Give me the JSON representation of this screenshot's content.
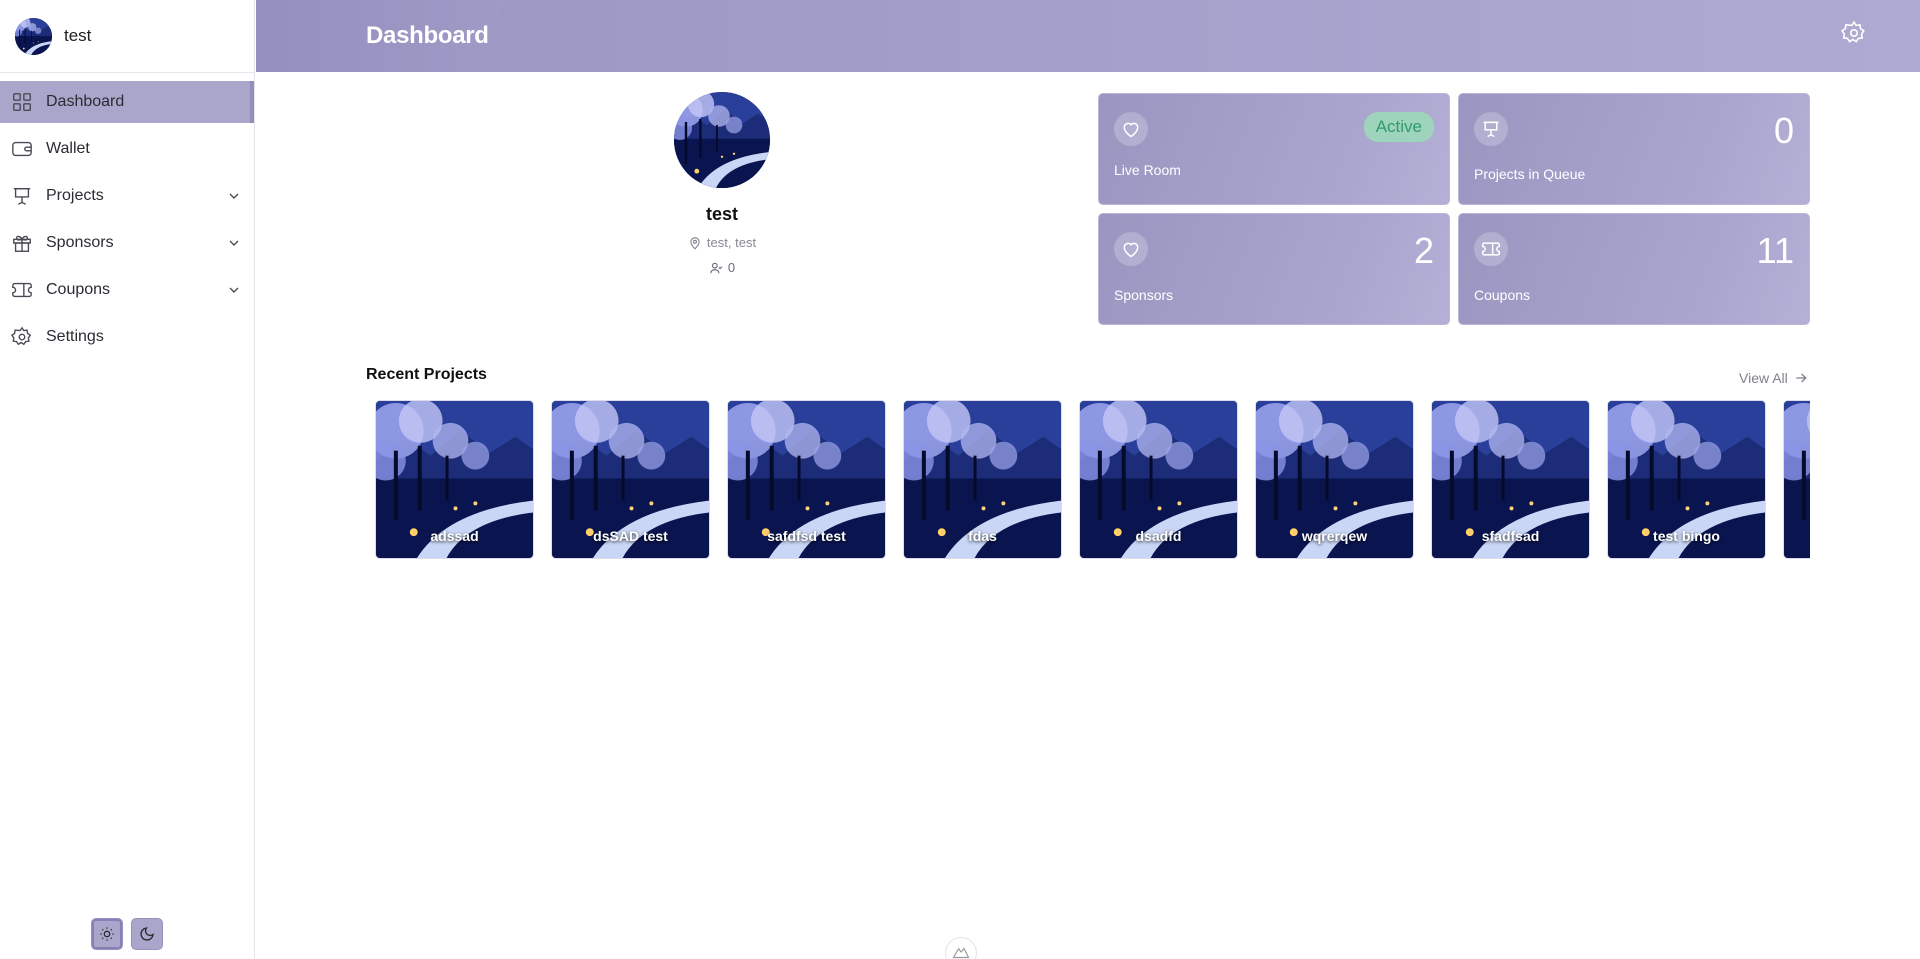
{
  "user": {
    "name": "test"
  },
  "sidebar": {
    "items": [
      {
        "label": "Dashboard",
        "icon": "dashboard-grid-icon",
        "active": true,
        "has_children": false
      },
      {
        "label": "Wallet",
        "icon": "wallet-icon",
        "active": false,
        "has_children": false
      },
      {
        "label": "Projects",
        "icon": "presentation-icon",
        "active": false,
        "has_children": true
      },
      {
        "label": "Sponsors",
        "icon": "gift-icon",
        "active": false,
        "has_children": true
      },
      {
        "label": "Coupons",
        "icon": "ticket-icon",
        "active": false,
        "has_children": true
      },
      {
        "label": "Settings",
        "icon": "gear-icon",
        "active": false,
        "has_children": false
      }
    ]
  },
  "header": {
    "title": "Dashboard"
  },
  "profile": {
    "name": "test",
    "location": "test, test",
    "followers": "0"
  },
  "cards": {
    "live_room": {
      "label": "Live Room",
      "status": "Active"
    },
    "projects_queue": {
      "label": "Projects in Queue",
      "value": "0"
    },
    "sponsors": {
      "label": "Sponsors",
      "value": "2"
    },
    "coupons": {
      "label": "Coupons",
      "value": "11"
    }
  },
  "recent_projects": {
    "title": "Recent Projects",
    "view_all": "View All",
    "items": [
      "adssad",
      "dsSAD test",
      "safdfsd test",
      "fdas",
      "dsadfd",
      "wqrerqew",
      "sfadfsad",
      "test bingo",
      ""
    ]
  },
  "colors": {
    "accent": "#aaa6cb",
    "header": "#a6a1cc",
    "badge_bg": "#9fd4bc",
    "badge_text": "#2f9b6b"
  }
}
